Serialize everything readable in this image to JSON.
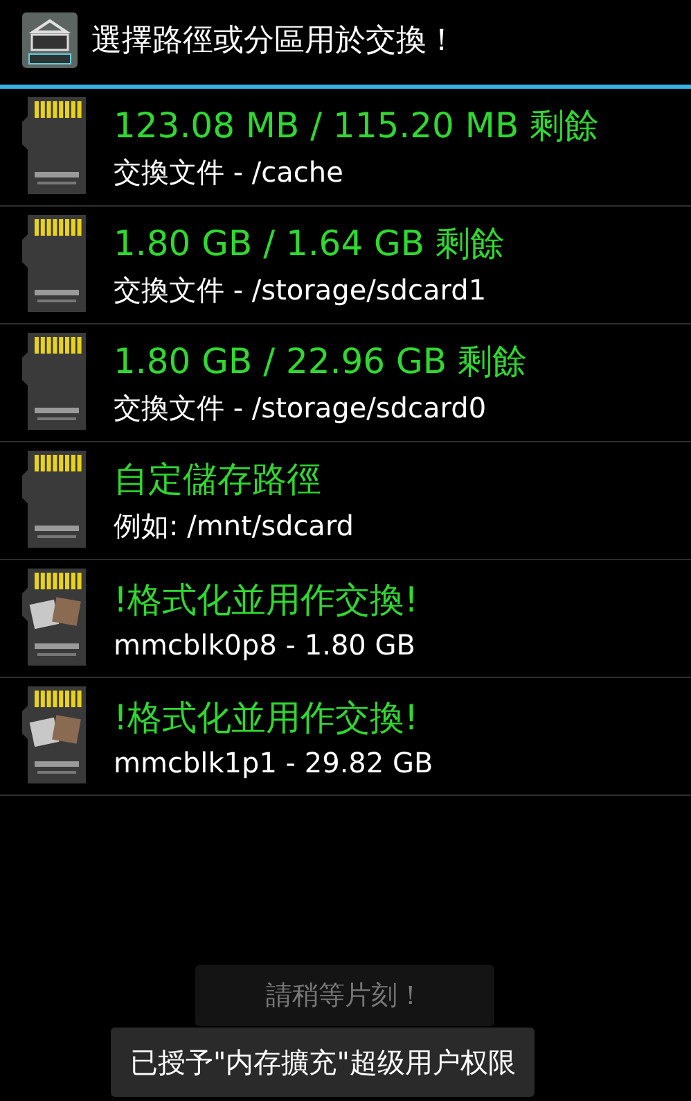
{
  "window": {
    "title": "選擇路徑或分區用於交換！"
  },
  "items": [
    {
      "kind": "storage",
      "primary": "123.08 MB / 115.20 MB 剩餘",
      "secondary": "交換文件 - /cache"
    },
    {
      "kind": "storage",
      "primary": "1.80 GB / 1.64 GB 剩餘",
      "secondary": "交換文件 - /storage/sdcard1"
    },
    {
      "kind": "storage",
      "primary": "1.80 GB / 22.96 GB 剩餘",
      "secondary": "交換文件 - /storage/sdcard0"
    },
    {
      "kind": "storage",
      "primary": "自定儲存路徑",
      "secondary": "例如: /mnt/sdcard"
    },
    {
      "kind": "partition",
      "primary": "!格式化並用作交換!",
      "secondary": "mmcblk0p8 - 1.80 GB"
    },
    {
      "kind": "partition",
      "primary": "!格式化並用作交換!",
      "secondary": "mmcblk1p1 - 29.82 GB"
    }
  ],
  "toasts": [
    {
      "text": "請稍等片刻！"
    },
    {
      "text": "已授予\"内存擴充\"超级用户权限"
    }
  ]
}
